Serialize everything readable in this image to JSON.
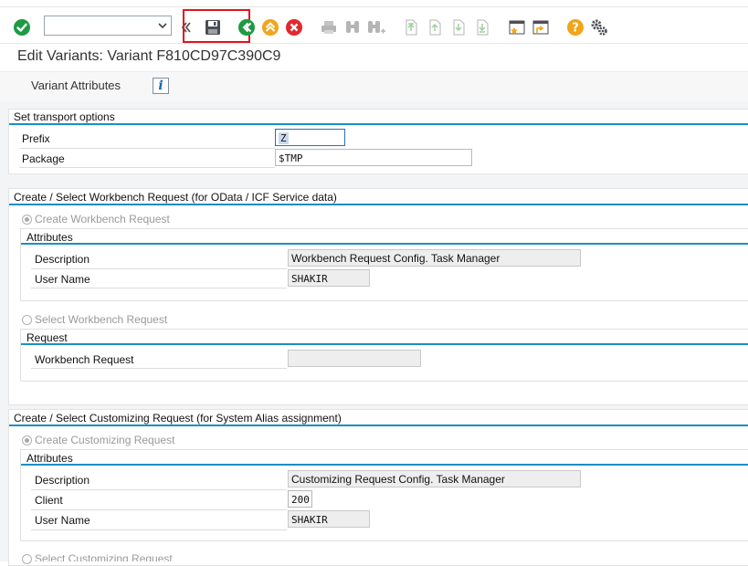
{
  "toolbar": {
    "command_field_value": "",
    "icons": [
      "enter-icon",
      "save-icon",
      "back-icon",
      "exit-icon",
      "cancel-icon",
      "print-icon",
      "find-icon",
      "find-next-icon",
      "first-page-icon",
      "previous-page-icon",
      "next-page-icon",
      "last-page-icon",
      "create-session-icon",
      "shortcut-icon",
      "help-icon",
      "customize-layout-icon"
    ]
  },
  "header": {
    "title": "Edit Variants: Variant F810CD97C390C9"
  },
  "tabs": {
    "variant_attributes": "Variant Attributes",
    "info_glyph": "i"
  },
  "transport": {
    "title": "Set transport options",
    "prefix_label": "Prefix",
    "prefix_value": "Z",
    "package_label": "Package",
    "package_value": "$TMP"
  },
  "workbench": {
    "title": "Create / Select Workbench Request (for OData / ICF Service data)",
    "create_label": "Create Workbench Request",
    "attributes_title": "Attributes",
    "description_label": "Description",
    "description_value": "Workbench Request Config. Task Manager",
    "username_label": "User Name",
    "username_value": "SHAKIR",
    "select_label": "Select Workbench Request",
    "request_title": "Request",
    "request_label": "Workbench Request",
    "request_value": ""
  },
  "customizing": {
    "title": "Create / Select Customizing Request (for System Alias assignment)",
    "create_label": "Create Customizing Request",
    "attributes_title": "Attributes",
    "description_label": "Description",
    "description_value": "Customizing Request Config. Task Manager",
    "client_label": "Client",
    "client_value": "200",
    "username_label": "User Name",
    "username_value": "SHAKIR",
    "select_label": "Select Customizing Request"
  },
  "colors": {
    "accent_blue": "#1b8ec4",
    "highlight_red": "#e0141e",
    "enter_green": "#1e9a43",
    "cancel_red": "#e0282e",
    "help_orange": "#f0a51b"
  }
}
